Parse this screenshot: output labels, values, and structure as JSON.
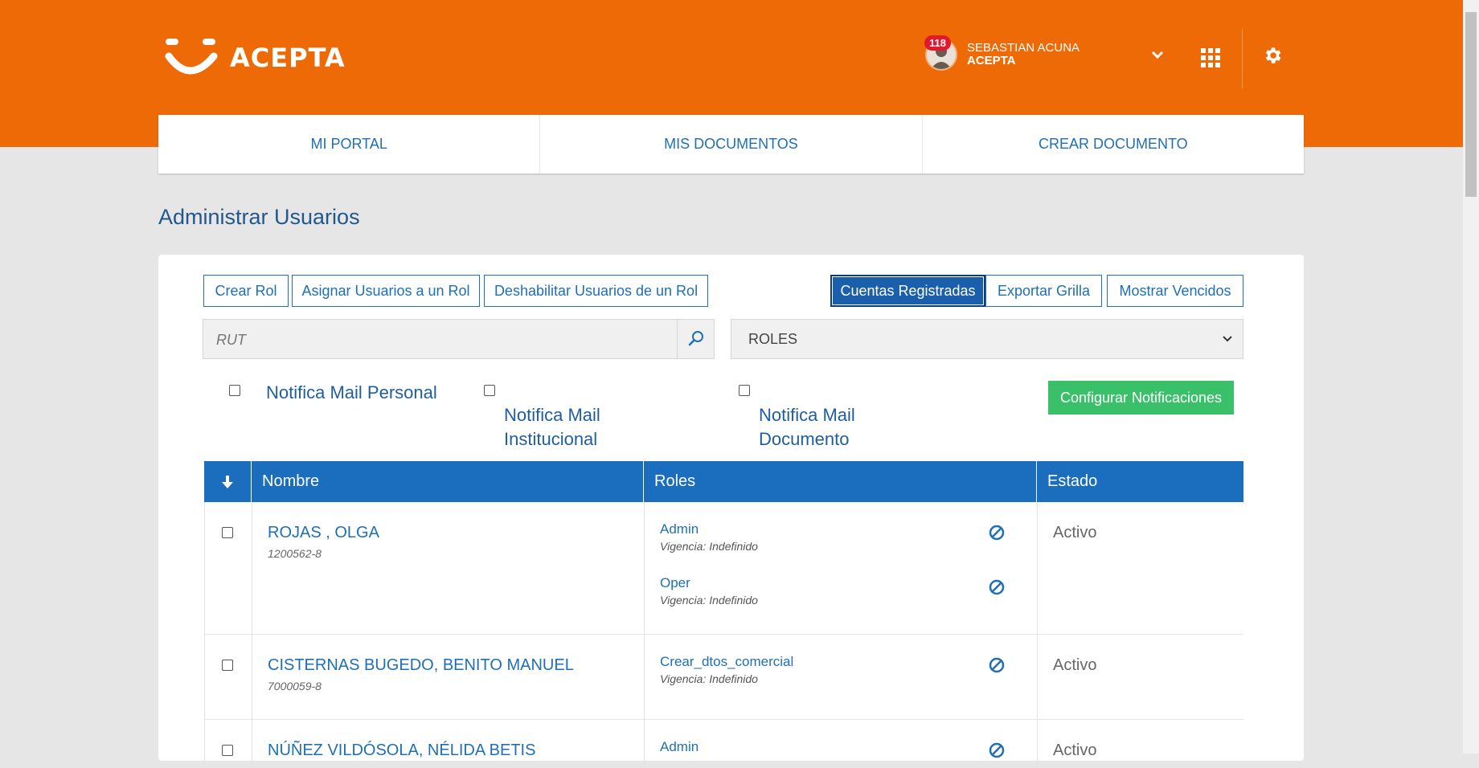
{
  "brand": {
    "name": "ACEPTA",
    "color": "#ee6a07"
  },
  "user": {
    "badge": "118",
    "name": "SEBASTIAN ACUNA",
    "company": "ACEPTA"
  },
  "nav": {
    "items": [
      "MI PORTAL",
      "MIS DOCUMENTOS",
      "CREAR DOCUMENTO"
    ]
  },
  "page": {
    "title": "Administrar Usuarios"
  },
  "toolbar": {
    "crear_rol": "Crear Rol",
    "asignar": "Asignar Usuarios a un Rol",
    "deshabilitar": "Deshabilitar Usuarios de un Rol",
    "cuentas": "Cuentas Registradas",
    "exportar": "Exportar Grilla",
    "vencidos": "Mostrar Vencidos"
  },
  "search": {
    "placeholder": "RUT"
  },
  "roles_select": {
    "value": "ROLES"
  },
  "notifications": {
    "personal": "Notifica Mail Personal",
    "institucional_1": "Notifica Mail",
    "institucional_2": "Institucional",
    "documento_1": "Notifica Mail",
    "documento_2": "Documento",
    "configure": "Configurar Notificaciones"
  },
  "table": {
    "headers": {
      "nombre": "Nombre",
      "roles": "Roles",
      "estado": "Estado"
    },
    "rows": [
      {
        "name": "ROJAS , OLGA",
        "rut": "1200562-8",
        "roles": [
          {
            "name": "Admin",
            "vigencia": "Vigencia: Indefinido"
          },
          {
            "name": "Oper",
            "vigencia": "Vigencia: Indefinido"
          }
        ],
        "estado": "Activo"
      },
      {
        "name": "CISTERNAS BUGEDO, BENITO MANUEL",
        "rut": "7000059-8",
        "roles": [
          {
            "name": "Crear_dtos_comercial",
            "vigencia": "Vigencia: Indefinido"
          }
        ],
        "estado": "Activo"
      },
      {
        "name": "NÚÑEZ VILDÓSOLA, NÉLIDA BETIS",
        "rut": "",
        "roles": [
          {
            "name": "Admin",
            "vigencia": ""
          }
        ],
        "estado": "Activo"
      }
    ]
  },
  "colors": {
    "primary": "#1f6fb5",
    "header": "#1b6dbe",
    "success": "#3bc06a",
    "badge": "#e2192c"
  }
}
